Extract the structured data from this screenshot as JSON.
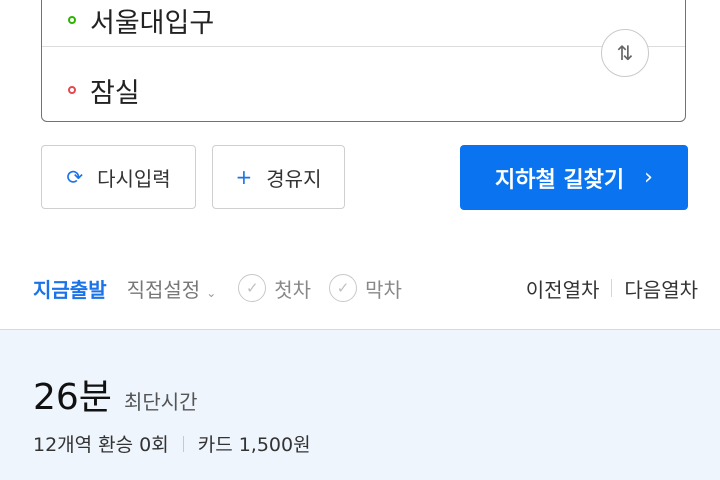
{
  "route": {
    "from_station": "서울대입구",
    "to_station": "잠실",
    "swap_icon": "swap-vertical-icon"
  },
  "actions": {
    "reset_label": "다시입력",
    "waypoint_label": "경유지",
    "search_label": "지하철 길찾기"
  },
  "options": {
    "depart_now": "지금출발",
    "custom_set": "직접설정",
    "first_train": "첫차",
    "last_train": "막차",
    "prev_train": "이전열차",
    "next_train": "다음열차"
  },
  "result": {
    "duration": "26분",
    "duration_label": "최단시간",
    "stations_transfers": "12개역 환승 0회",
    "fare_type": "카드",
    "fare": "1,500원"
  },
  "colors": {
    "accent": "#0a74f0",
    "origin": "#2db400",
    "destination": "#e5484d",
    "result_bg": "#eef5fd"
  }
}
